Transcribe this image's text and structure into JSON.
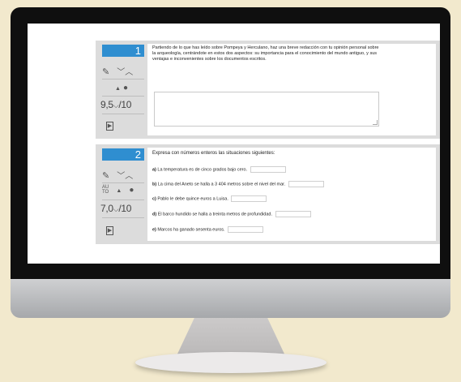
{
  "questions": [
    {
      "number": "1",
      "grade": "9,5",
      "grade_max": "/10",
      "dropdown": "⌵",
      "prompt": "Partiendo de lo que has leído sobre Pompeya y Herculano, haz una breve redacción con tu opinión personal sobre la arqueología, centrándote en estos dos aspectos: su importancia para el conocimiento del mundo antiguo, y sus ventajas e inconvenientes sobre los documentos escritos.",
      "answer": ""
    },
    {
      "number": "2",
      "grade": "7,0",
      "grade_max": "/10",
      "dropdown": "⌵",
      "auto_label_top": "AU",
      "auto_label_bottom": "TO",
      "prompt": "Expresa con números enteros las situaciones siguientes:",
      "items": [
        {
          "letter": "a)",
          "text": "La temperatura es de cinco grados bajo cero."
        },
        {
          "letter": "b)",
          "text": "La cima del Aneto se halla a 3 404 metros sobre el nivel del mar."
        },
        {
          "letter": "c)",
          "text": "Pablo le debe quince euros a Luisa."
        },
        {
          "letter": "d)",
          "text": "El barco hundido se halla a treinta metros de profundidad."
        },
        {
          "letter": "e)",
          "text": "Marcos ha ganado sesenta euros."
        }
      ]
    }
  ],
  "icons": {
    "pencil": "✎",
    "arrows": "﹀︿",
    "arrow_up": "▲",
    "circle": "●",
    "doc": "▶"
  },
  "colors": {
    "accent": "#2f8ed0",
    "panel_bg": "#dcdcdc",
    "desk_bg": "#f2e9cd"
  }
}
